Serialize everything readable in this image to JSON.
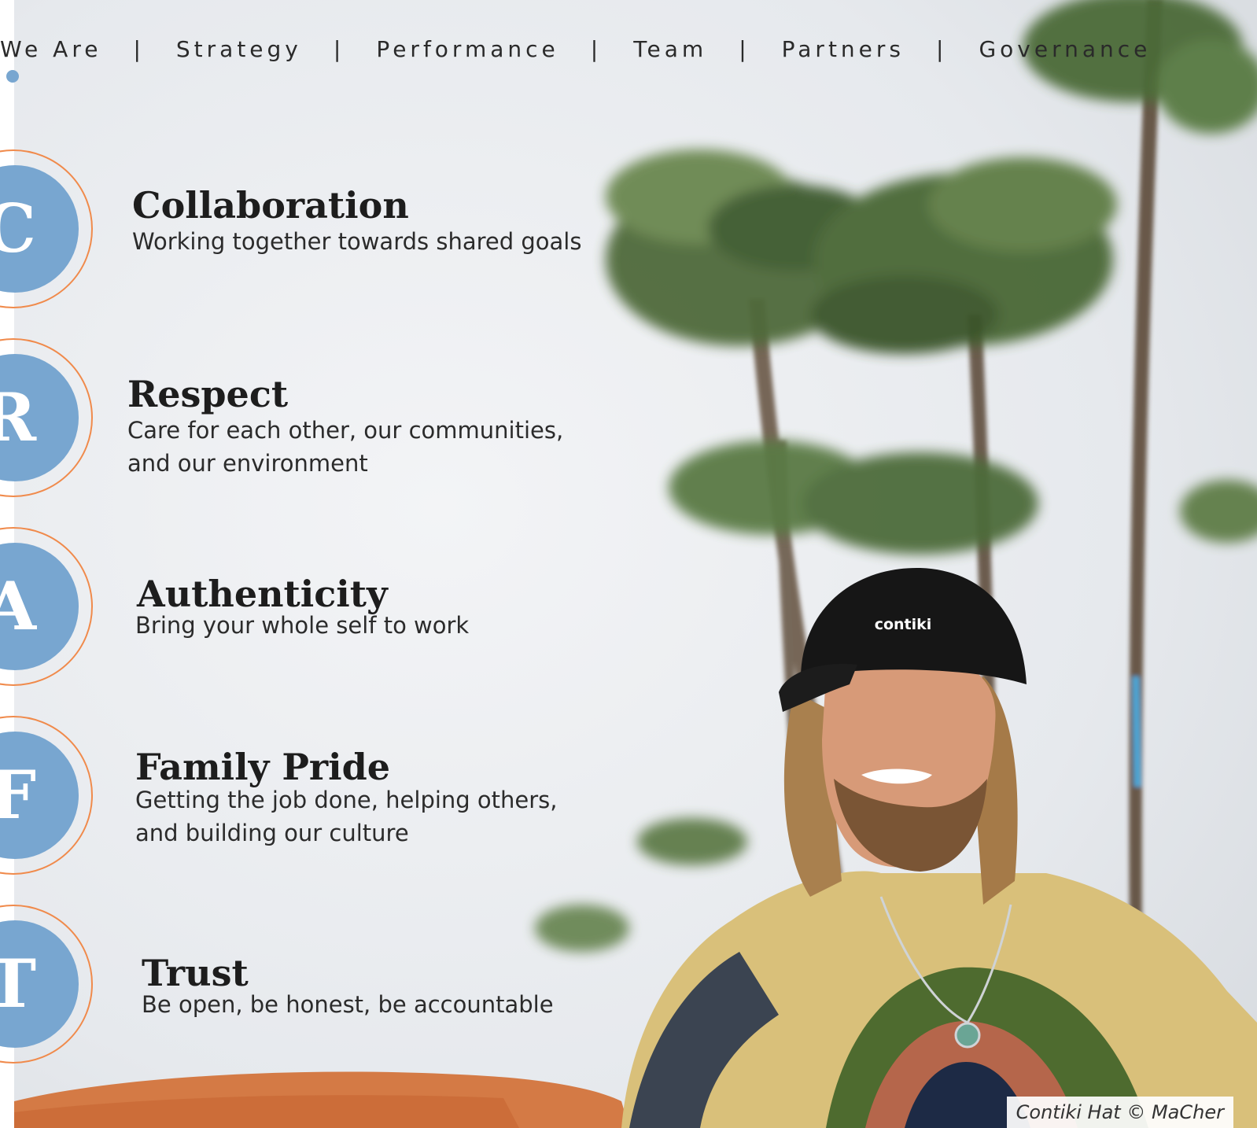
{
  "nav": {
    "items": [
      "We Are",
      "Strategy",
      "Performance",
      "Team",
      "Partners",
      "Governance"
    ],
    "separator": "|"
  },
  "values": [
    {
      "letter": "C",
      "title": "Collaboration",
      "description": "Working together towards shared goals"
    },
    {
      "letter": "R",
      "title": "Respect",
      "description": "Care for each other, our communities, and our environment"
    },
    {
      "letter": "A",
      "title": "Authenticity",
      "description": "Bring your whole self to work"
    },
    {
      "letter": "F",
      "title": "Family Pride",
      "description": "Getting the job done, helping others, and building our culture"
    },
    {
      "letter": "T",
      "title": "Trust",
      "description": "Be open, be honest, be accountable"
    }
  ],
  "photo": {
    "cap_text": "contiki",
    "credit": "Contiki Hat © MaCher"
  },
  "colors": {
    "accent_blue": "#78a6d0",
    "accent_orange": "#f08a4b"
  }
}
